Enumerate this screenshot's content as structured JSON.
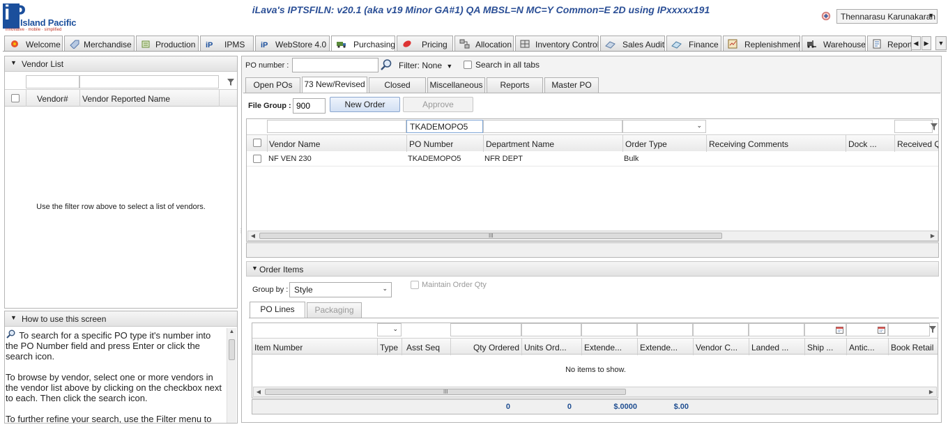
{
  "app": {
    "logo_name": "Island Pacific",
    "logo_tagline": "innovative · mobile · simplified",
    "title": "iLava's IPTSFILN: v20.1 (aka v19 Minor GA#1) QA MBSL=N MC=Y Common=E 2D using IPxxxxx191",
    "user": "Thennarasu Karunakaran"
  },
  "tabs": [
    {
      "label": "Welcome",
      "icon": "flower-icon"
    },
    {
      "label": "Merchandise",
      "icon": "tag-icon"
    },
    {
      "label": "Production",
      "icon": "production-icon"
    },
    {
      "label": "IPMS",
      "icon": "ip-icon"
    },
    {
      "label": "WebStore 4.0",
      "icon": "ip-icon"
    },
    {
      "label": "Purchasing",
      "icon": "truck-icon",
      "selected": true
    },
    {
      "label": "Pricing",
      "icon": "price-tag-icon"
    },
    {
      "label": "Allocation",
      "icon": "allocation-icon"
    },
    {
      "label": "Inventory Control",
      "icon": "inventory-icon"
    },
    {
      "label": "Sales Audit",
      "icon": "sales-audit-icon"
    },
    {
      "label": "Finance",
      "icon": "finance-icon"
    },
    {
      "label": "Replenishment",
      "icon": "replenishment-icon"
    },
    {
      "label": "Warehouse",
      "icon": "forklift-icon"
    },
    {
      "label": "Reports",
      "icon": "reports-icon"
    }
  ],
  "vendor_list": {
    "title": "Vendor List",
    "columns": [
      "Vendor#",
      "Vendor Reported Name"
    ],
    "empty_message": "Use the filter row above to select a list of vendors."
  },
  "help": {
    "title": "How to use this screen",
    "paragraphs": [
      "To search for a specific PO type it's number into the PO Number field and press Enter or click the search icon.",
      "To browse by vendor, select one or more vendors in the vendor list above by clicking on the checkbox next to each. Then click the search icon.",
      "To further refine your search, use the Filter menu to"
    ]
  },
  "po_search": {
    "po_label": "PO number :",
    "po_value": "",
    "filter_label": "Filter: None",
    "search_all_label": "Search in all tabs"
  },
  "po_tabs": [
    "Open POs",
    "73 New/Revised",
    "Closed",
    "Miscellaneous",
    "Reports",
    "Master PO"
  ],
  "po_tab_selected": 1,
  "file_group": {
    "label": "File Group :",
    "value": "900"
  },
  "buttons": {
    "new_order": "New Order",
    "approve": "Approve"
  },
  "po_grid": {
    "filter_po_number": "TKADEMOPO5",
    "columns": [
      "Vendor Name",
      "PO Number",
      "Department Name",
      "Order Type",
      "Receiving Comments",
      "Dock ...",
      "Received Qu"
    ],
    "rows": [
      {
        "vendor_name": "NF VEN 230",
        "po_number": "TKADEMOPO5",
        "department": "NFR DEPT",
        "order_type": "Bulk",
        "receiving_comments": "",
        "dock": "",
        "received_qty": ""
      }
    ]
  },
  "order_items": {
    "title": "Order Items",
    "group_by_label": "Group by :",
    "group_by_value": "Style",
    "maintain_qty_label": "Maintain Order Qty",
    "tabs": [
      "PO Lines",
      "Packaging"
    ],
    "columns": [
      "Item Number",
      "Type",
      "Asst Seq",
      "Qty Ordered",
      "Units Ord...",
      "Extende...",
      "Extende...",
      "Vendor C...",
      "Landed ...",
      "Ship ...",
      "Antic...",
      "Book Retail"
    ],
    "empty_message": "No items to show.",
    "totals": {
      "qty_ordered": "0",
      "units_ordered": "0",
      "extended_cost": "$.0000",
      "extended_retail": "$.00"
    }
  }
}
